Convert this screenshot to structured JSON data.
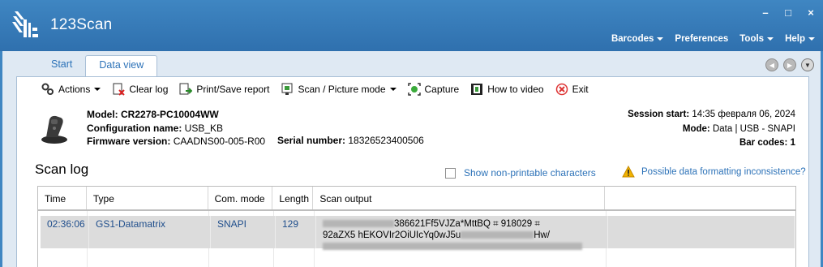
{
  "app": {
    "title": "123Scan"
  },
  "window_controls": {
    "minimize": "–",
    "maximize": "□",
    "close": "×"
  },
  "menu": [
    {
      "label": "Barcodes",
      "has_dropdown": true
    },
    {
      "label": "Preferences",
      "has_dropdown": false
    },
    {
      "label": "Tools",
      "has_dropdown": true
    },
    {
      "label": "Help",
      "has_dropdown": true
    }
  ],
  "tabs": [
    {
      "label": "Start",
      "active": false
    },
    {
      "label": "Data view",
      "active": true
    }
  ],
  "toolbar": {
    "actions": "Actions",
    "clear_log": "Clear log",
    "print_save": "Print/Save report",
    "scan_picture": "Scan / Picture mode",
    "capture": "Capture",
    "how_to": "How to video",
    "exit": "Exit"
  },
  "device": {
    "model_label": "Model:",
    "model_value": "CR2278-PC10004WW",
    "config_label": "Configuration name:",
    "config_value": "USB_KB",
    "firmware_label": "Firmware version:",
    "firmware_value": "CAADNS00-005-R00",
    "serial_label": "Serial number:",
    "serial_value": "18326523400506"
  },
  "session": {
    "start_label": "Session start:",
    "start_value": "14:35 февраля 06, 2024",
    "mode_label": "Mode:",
    "mode_value": "Data | USB - SNAPI",
    "barcodes_label": "Bar codes:",
    "barcodes_value": "1"
  },
  "scan_log": {
    "title": "Scan log",
    "show_nonprintable": "Show non-printable characters",
    "warning": "Possible data formatting inconsistence?",
    "columns": [
      "Time",
      "Type",
      "Com. mode",
      "Length",
      "Scan output"
    ],
    "rows": [
      {
        "time": "02:36:06",
        "type": "GS1-Datamatrix",
        "com_mode": "SNAPI",
        "length": "129",
        "line1": "386621Ff5VJZa*MttBQ ⌗ 918029 ⌗",
        "line2": "92aZX5 hEKOVIr2OiUIcYq0wJ5u",
        "line2_end": "Hw/"
      }
    ]
  },
  "colors": {
    "titlebar": "#3a7dbd",
    "link": "#2c72b8",
    "row_selected": "#dcdcdc"
  }
}
